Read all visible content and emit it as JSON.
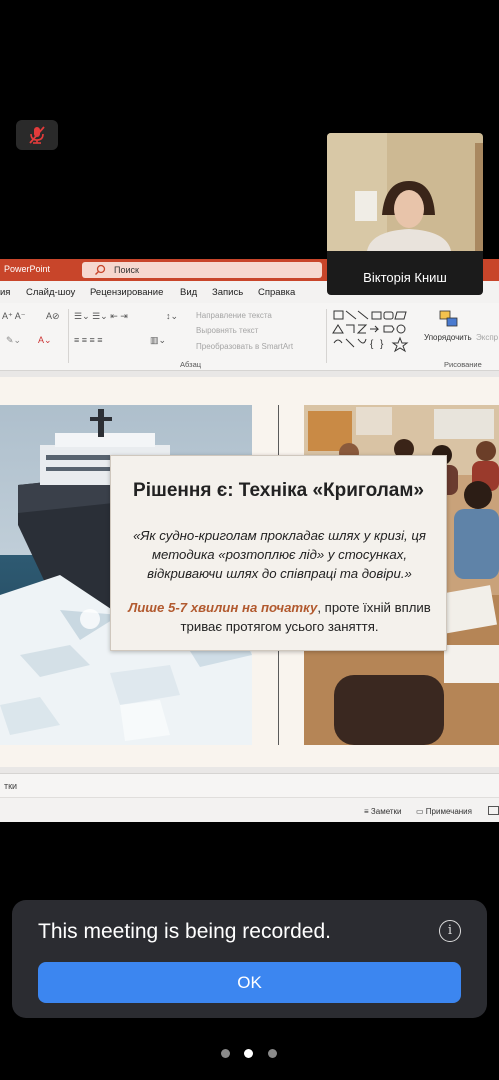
{
  "meeting": {
    "participant_name": "Вікторія Книш",
    "recording_message": "This meeting is being recorded.",
    "ok_label": "OK",
    "info_glyph": "i",
    "page_dots": {
      "count": 3,
      "active_index": 1
    }
  },
  "ppt": {
    "app_name": "PowerPoint",
    "search_placeholder": "Поиск",
    "tabs": [
      "ия",
      "Слайд-шоу",
      "Рецензирование",
      "Вид",
      "Запись",
      "Справка"
    ],
    "ribbon": {
      "text_direction": "Направление текста",
      "align_text": "Выровнять текст",
      "convert_smartart": "Преобразовать в SmartArt",
      "group_paragraph": "Абзац",
      "arrange_label": "Упорядочить",
      "express_styles": "Экспр стил",
      "group_drawing": "Рисование"
    },
    "notes_placeholder": "тки",
    "status": {
      "notes": "Заметки",
      "comments": "Примечания"
    }
  },
  "slide": {
    "heading": "Рішення є: Техніка «Криголам»",
    "quote": "«Як судно-криголам прокладає шлях у кризі, ця методика «розтоплює лід» у стосунках, відкриваючи шлях до співпраці та довіри.»",
    "accent_text": "Лише 5-7 хвилин на початку",
    "body_rest": ", проте їхній вплив триває протягом усього заняття."
  },
  "colors": {
    "titlebar": "#c8452a",
    "ok_button": "#3c86f0",
    "accent_text": "#b25a2f",
    "banner_bg": "#2b2c31"
  },
  "icons": [
    "mic-muted-icon",
    "search-icon",
    "info-icon",
    "notes-icon",
    "comments-icon"
  ]
}
